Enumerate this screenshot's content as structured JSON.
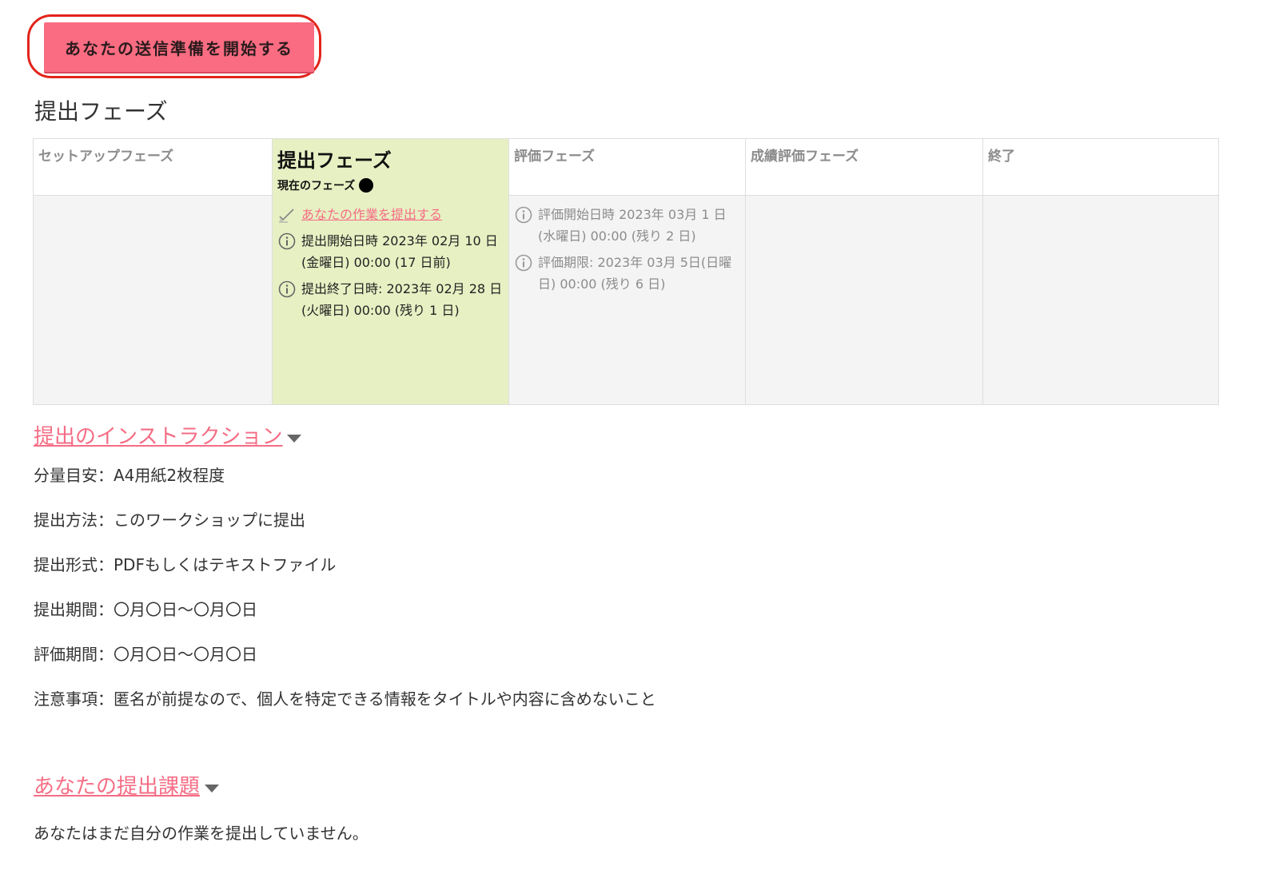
{
  "start_button": {
    "label": "あなたの送信準備を開始する"
  },
  "page": {
    "title": "提出フェーズ"
  },
  "phases": [
    {
      "name": "セットアップフェーズ",
      "active": false,
      "tasks": []
    },
    {
      "name": "提出フェーズ",
      "active": true,
      "current_label": "現在のフェーズ",
      "tasks": [
        {
          "type": "link",
          "icon": "check-icon",
          "text": "あなたの作業を提出する"
        },
        {
          "type": "info",
          "icon": "info-icon",
          "text": "提出開始日時 2023年 02月 10 日(金曜日) 00:00 (17 日前)"
        },
        {
          "type": "info",
          "icon": "info-icon",
          "text": "提出終了日時: 2023年 02月 28 日(火曜日) 00:00 (残り 1 日)"
        }
      ]
    },
    {
      "name": "評価フェーズ",
      "active": false,
      "tasks": [
        {
          "type": "info",
          "icon": "info-icon",
          "text": "評価開始日時 2023年 03月 1 日(水曜日) 00:00 (残り 2 日)"
        },
        {
          "type": "info",
          "icon": "info-icon",
          "text": "評価期限: 2023年 03月 5日(日曜日) 00:00 (残り 6 日)"
        }
      ]
    },
    {
      "name": "成績評価フェーズ",
      "active": false,
      "tasks": []
    },
    {
      "name": "終了",
      "active": false,
      "tasks": []
    }
  ],
  "instructions": {
    "heading": "提出のインストラクション",
    "lines": [
      "分量目安：A4用紙2枚程度",
      "提出方法：このワークショップに提出",
      "提出形式：PDFもしくはテキストファイル",
      "提出期間：〇月〇日〜〇月〇日",
      "評価期間：〇月〇日〜〇月〇日",
      "注意事項：匿名が前提なので、個人を特定できる情報をタイトルや内容に含めないこと"
    ]
  },
  "submission": {
    "heading": "あなたの提出課題",
    "empty_message": "あなたはまだ自分の作業を提出していません。"
  },
  "colors": {
    "accent": "#f56d85",
    "button": "#f96c81",
    "highlight_ring": "#e3241b",
    "active_phase": "#e7f0c3"
  }
}
